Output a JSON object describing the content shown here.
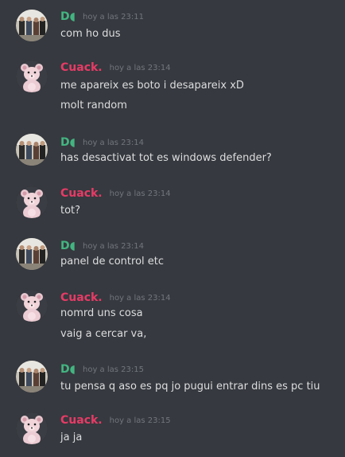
{
  "colors": {
    "background": "#36393f",
    "user_d": "#43b581",
    "user_cuack": "#e73b66",
    "timestamp": "#72767d",
    "message_text": "#dcddde"
  },
  "messages": [
    {
      "user": "D◖",
      "user_style": "d",
      "avatar": "group-photo-avatar",
      "timestamp": "hoy a las 23:11",
      "lines": [
        "com ho dus"
      ]
    },
    {
      "user": "Cuack.",
      "user_style": "cuack",
      "avatar": "teddy-bear-avatar",
      "timestamp": "hoy a las 23:14",
      "lines": [
        "me apareix es boto i desapareix xD",
        "molt random"
      ]
    },
    {
      "user": "D◖",
      "user_style": "d",
      "avatar": "group-photo-avatar",
      "timestamp": "hoy a las 23:14",
      "lines": [
        "has desactivat tot es windows defender?"
      ]
    },
    {
      "user": "Cuack.",
      "user_style": "cuack",
      "avatar": "teddy-bear-avatar",
      "timestamp": "hoy a las 23:14",
      "lines": [
        "tot?"
      ]
    },
    {
      "user": "D◖",
      "user_style": "d",
      "avatar": "group-photo-avatar",
      "timestamp": "hoy a las 23:14",
      "lines": [
        "panel de control etc"
      ]
    },
    {
      "user": "Cuack.",
      "user_style": "cuack",
      "avatar": "teddy-bear-avatar",
      "timestamp": "hoy a las 23:14",
      "lines": [
        "nomrd uns cosa",
        "vaig a cercar va,"
      ]
    },
    {
      "user": "D◖",
      "user_style": "d",
      "avatar": "group-photo-avatar",
      "timestamp": "hoy a las 23:15",
      "lines": [
        "tu pensa q aso es pq jo pugui entrar dins es pc tiu"
      ]
    },
    {
      "user": "Cuack.",
      "user_style": "cuack",
      "avatar": "teddy-bear-avatar",
      "timestamp": "hoy a las 23:15",
      "lines": [
        "ja ja"
      ]
    }
  ]
}
